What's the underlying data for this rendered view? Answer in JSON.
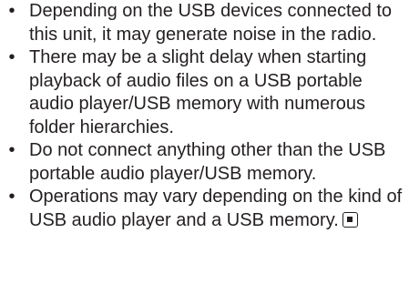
{
  "bullets": [
    {
      "text": "Depending on the USB devices connected to this unit, it may generate noise in the radio."
    },
    {
      "text": "There may be a slight delay when starting playback of audio files on a USB portable audio player/USB memory with numerous folder hierarchies."
    },
    {
      "text": "Do not connect anything other than the USB portable audio player/USB memory."
    },
    {
      "text": "Operations may vary depending on the kind of USB audio player and a USB memory."
    }
  ],
  "bullet_symbol": "•",
  "end_mark_icon": "end-of-section-icon"
}
